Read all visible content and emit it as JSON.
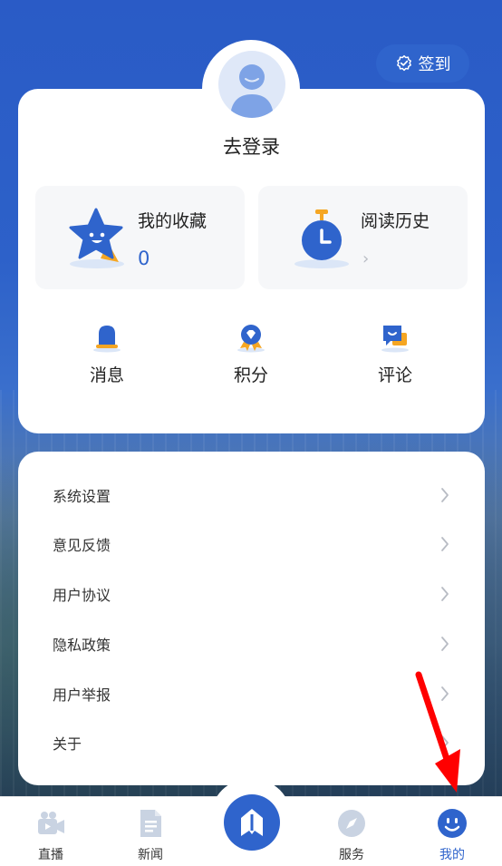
{
  "header": {
    "checkin_label": "签到"
  },
  "profile": {
    "login_label": "去登录"
  },
  "tiles": [
    {
      "title": "我的收藏",
      "count": "0"
    },
    {
      "title": "阅读历史",
      "chevron": "›"
    }
  ],
  "quick_actions": [
    {
      "label": "消息",
      "icon": "bell-icon"
    },
    {
      "label": "积分",
      "icon": "points-badge-icon"
    },
    {
      "label": "评论",
      "icon": "comment-icon"
    }
  ],
  "menu": [
    {
      "label": "系统设置"
    },
    {
      "label": "意见反馈"
    },
    {
      "label": "用户协议"
    },
    {
      "label": "隐私政策"
    },
    {
      "label": "用户举报"
    },
    {
      "label": "关于"
    }
  ],
  "tabbar": [
    {
      "label": "直播",
      "icon": "live-camera-icon"
    },
    {
      "label": "新闻",
      "icon": "news-document-icon"
    },
    {
      "label": "",
      "icon": "home-center-icon"
    },
    {
      "label": "服务",
      "icon": "compass-icon"
    },
    {
      "label": "我的",
      "icon": "smiley-profile-icon",
      "active": true
    }
  ],
  "colors": {
    "accent": "#2f64cc",
    "annotation_arrow": "#ff0000"
  }
}
